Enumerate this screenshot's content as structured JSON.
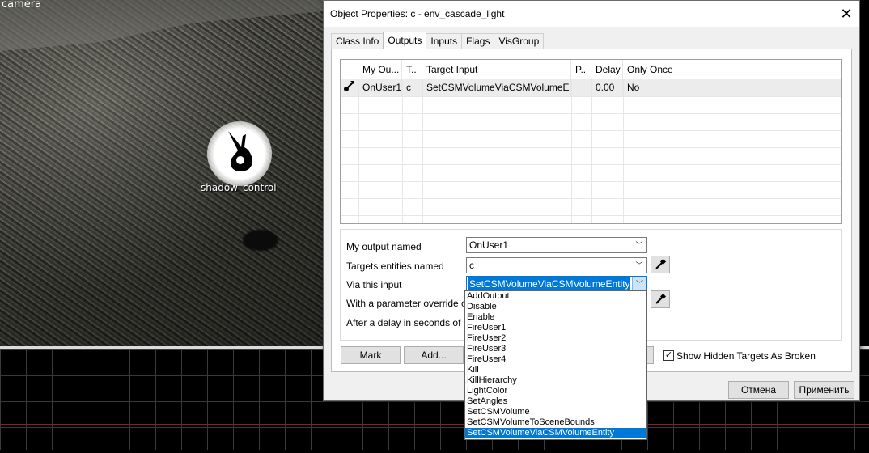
{
  "viewport3d": {
    "label": "camera",
    "entity_label": "shadow_control"
  },
  "dialog": {
    "title": "Object Properties: c - env_cascade_light",
    "tabs": [
      {
        "label": "Class Info",
        "active": false
      },
      {
        "label": "Outputs",
        "active": true
      },
      {
        "label": "Inputs",
        "active": false
      },
      {
        "label": "Flags",
        "active": false
      },
      {
        "label": "VisGroup",
        "active": false
      }
    ],
    "connections": {
      "columns": [
        "My Ou...",
        "T..",
        "Target Input",
        "P..",
        "Delay",
        "Only Once"
      ],
      "rows": [
        {
          "my_output": "OnUser1",
          "target": "c",
          "target_input": "SetCSMVolumeViaCSMVolumeEntity",
          "param": "",
          "delay": "0.00",
          "only_once": "No"
        }
      ]
    },
    "form": {
      "output_label": "My output named",
      "output_value": "OnUser1",
      "targets_label": "Targets entities named",
      "targets_value": "c",
      "input_label": "Via this input",
      "input_value": "SetCSMVolumeViaCSMVolumeEntity",
      "param_label": "With a parameter override of",
      "delay_label": "After a delay in seconds of"
    },
    "buttons": {
      "mark": "Mark",
      "add": "Add...",
      "cancel": "Отмена",
      "apply": "Применить"
    },
    "show_hidden_label": "Show Hidden Targets As Broken",
    "show_hidden_checked": true,
    "input_options": [
      "AddOutput",
      "Disable",
      "Enable",
      "FireUser1",
      "FireUser2",
      "FireUser3",
      "FireUser4",
      "Kill",
      "KillHierarchy",
      "LightColor",
      "SetAngles",
      "SetCSMVolume",
      "SetCSMVolumeToSceneBounds",
      "SetCSMVolumeViaCSMVolumeEntity"
    ],
    "input_selected_index": 13
  },
  "colors": {
    "selection": "#0078d7",
    "dialog_bg": "#f0f0f0"
  }
}
